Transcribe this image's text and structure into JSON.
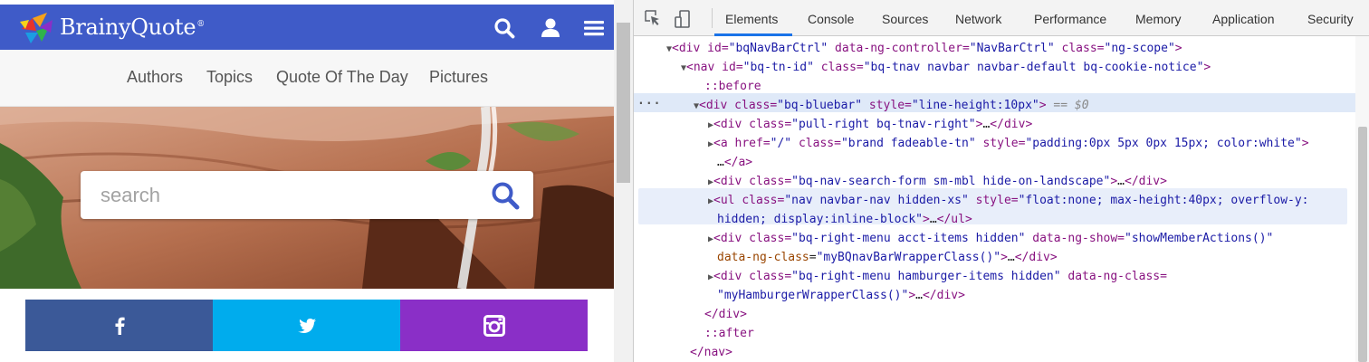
{
  "site": {
    "brand": "BrainyQuote",
    "brand_mark": "®",
    "nav_links": [
      "Authors",
      "Topics",
      "Quote Of The Day",
      "Pictures"
    ],
    "search_placeholder": "search",
    "social": [
      "facebook",
      "twitter",
      "instagram"
    ],
    "colors": {
      "bluebar": "#3f5bc8",
      "facebook": "#3b5998",
      "twitter": "#00aced",
      "instagram": "#8a2fc7"
    }
  },
  "devtools": {
    "tabs": [
      "Elements",
      "Console",
      "Sources",
      "Network",
      "Performance",
      "Memory",
      "Application",
      "Security"
    ],
    "active_tab": "Elements",
    "dom_lines": [
      "▼<div id=\"bqNavBarCtrl\" data-ng-controller=\"NavBarCtrl\" class=\"ng-scope\">",
      "▼<nav id=\"bq-tn-id\" class=\"bq-tnav navbar navbar-default bq-cookie-notice\">",
      "::before",
      "▼<div class=\"bq-bluebar\" style=\"line-height:10px\"> == $0",
      "▶<div class=\"pull-right bq-tnav-right\">…</div>",
      "▶<a href=\"/\" class=\"brand fadeable-tn\" style=\"padding:0px 5px 0px 15px; color:white\">",
      "…</a>",
      "▶<div class=\"bq-nav-search-form sm-mbl hide-on-landscape\">…</div>",
      "▶<ul class=\"nav navbar-nav hidden-xs\" style=\"float:none; max-height:40px; overflow-y:",
      "hidden; display:inline-block\">…</ul>",
      "▶<div class=\"bq-right-menu acct-items hidden\" data-ng-show=\"showMemberActions()\"",
      "data-ng-class=\"myBQnavBarWrapperClass()\">…</div>",
      "▶<div class=\"bq-right-menu hamburger-items hidden\" data-ng-class=",
      "\"myHamburgerWrapperClass()\">…</div>",
      "</div>",
      "::after",
      "</nav>"
    ],
    "selected_marker": "...",
    "colors": {
      "tag": "#881280",
      "attr_name": "#994500",
      "attr_value": "#1a1aa6",
      "accent": "#1a73e8"
    }
  }
}
